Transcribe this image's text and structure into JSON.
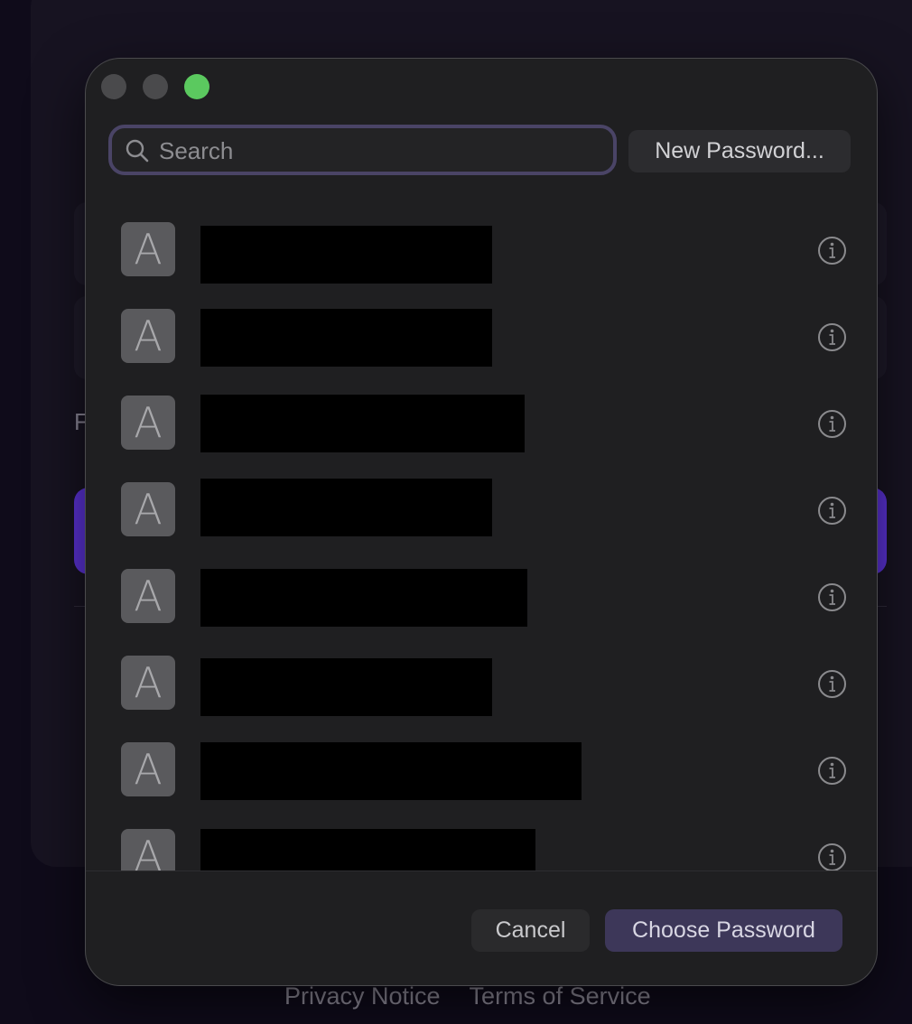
{
  "background": {
    "partial_label": "F",
    "footer": {
      "privacy_label": "Privacy Notice",
      "terms_label": "Terms of Service"
    }
  },
  "dialog": {
    "search": {
      "placeholder": "Search",
      "value": ""
    },
    "new_password_label": "New Password...",
    "entries": [
      {
        "avatar_letter": "A",
        "title": "",
        "redacted": true
      },
      {
        "avatar_letter": "A",
        "title": "",
        "redacted": true
      },
      {
        "avatar_letter": "A",
        "title": "",
        "redacted": true
      },
      {
        "avatar_letter": "A",
        "title": "",
        "redacted": true
      },
      {
        "avatar_letter": "A",
        "title": "",
        "redacted": true
      },
      {
        "avatar_letter": "A",
        "title": "",
        "redacted": true
      },
      {
        "avatar_letter": "A",
        "title": "",
        "redacted": true
      },
      {
        "avatar_letter": "A",
        "title": "",
        "redacted": true
      }
    ],
    "cancel_label": "Cancel",
    "choose_label": "Choose Password"
  },
  "colors": {
    "accent": "#5b32d6",
    "zoom_button": "#5bc95f",
    "primary_button": "#3d3759"
  }
}
